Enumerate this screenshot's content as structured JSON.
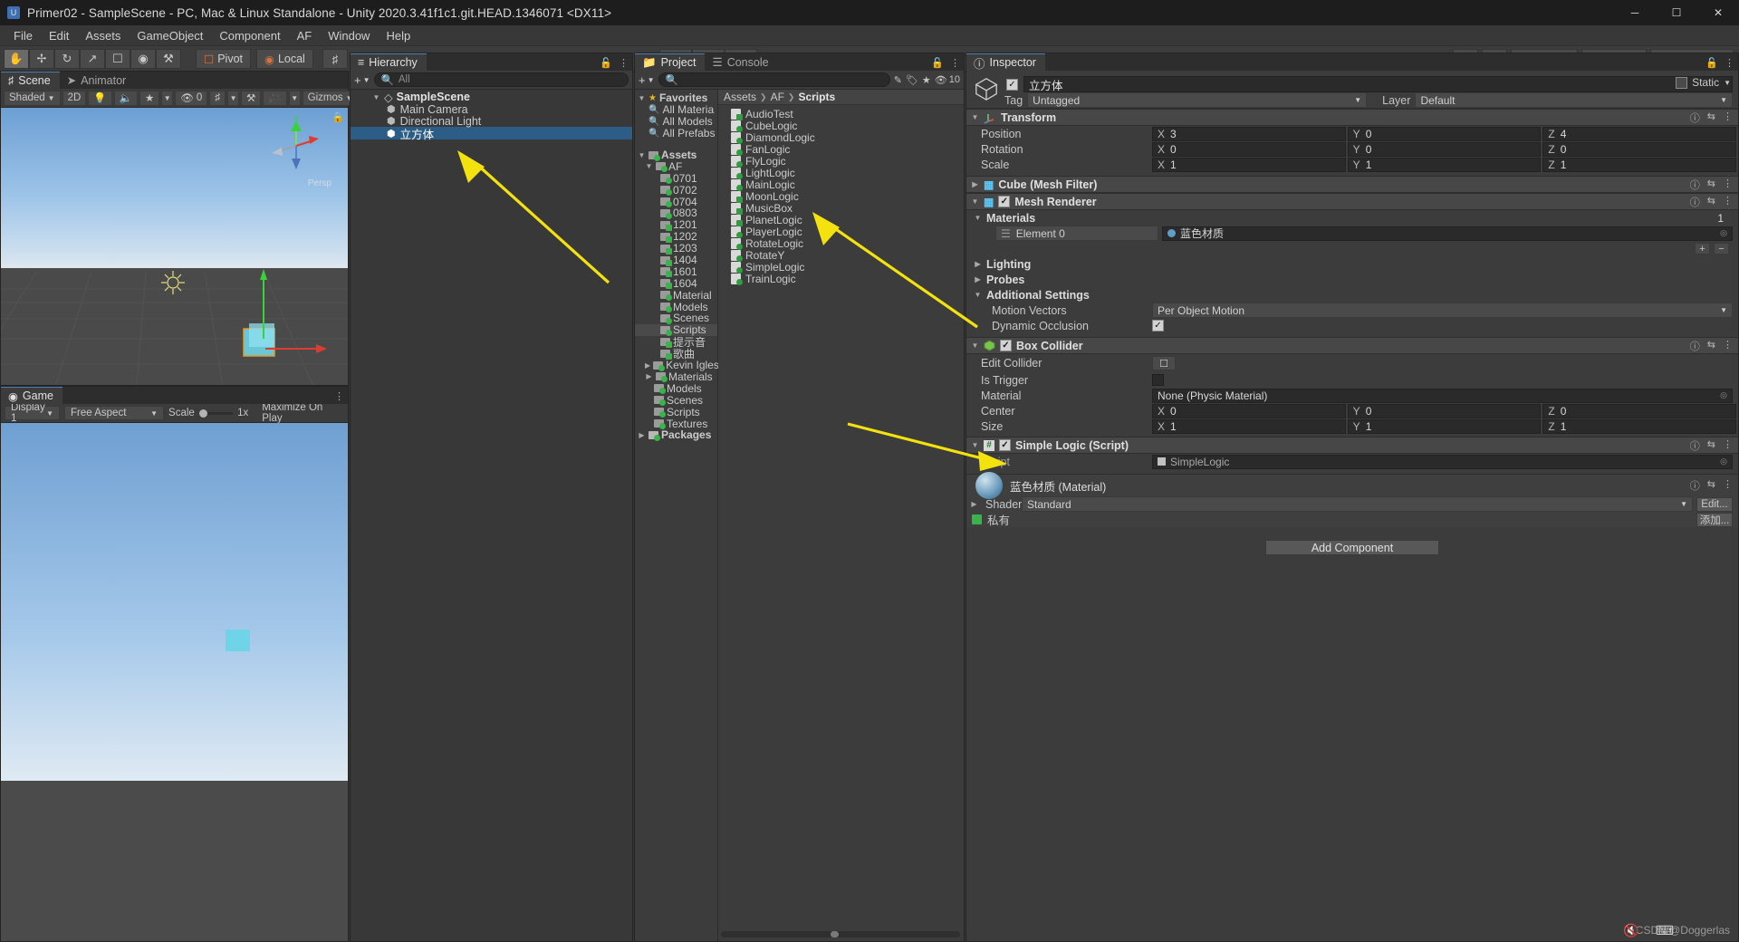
{
  "titlebar": {
    "title": "Primer02 - SampleScene - PC, Mac & Linux Standalone - Unity 2020.3.41f1c1.git.HEAD.1346071 <DX11>",
    "minimize": "─",
    "maximize": "☐",
    "close": "✕"
  },
  "menu": [
    "File",
    "Edit",
    "Assets",
    "GameObject",
    "Component",
    "AF",
    "Window",
    "Help"
  ],
  "toolbar": {
    "tools": [
      "hand-tool",
      "move-tool",
      "rotate-tool",
      "scale-tool",
      "rect-tool",
      "transform-tool",
      "custom-tool"
    ],
    "pivot": "Pivot",
    "local": "Local",
    "grid": "grid-snap",
    "play": "▶",
    "pause": "❙❙",
    "step": "▶❙",
    "cloud": "cloud-icon",
    "collab": "collab-icon",
    "account": "Account",
    "layers": "Layers",
    "layout": "Layout"
  },
  "scene": {
    "tabs": [
      {
        "label": "Scene",
        "icon": "grid-icon",
        "selected": true
      },
      {
        "label": "Animator",
        "icon": "animator-icon",
        "selected": false
      }
    ],
    "draw_mode": "Shaded",
    "mode_2d": "2D",
    "lighting": "light-icon",
    "audio": "audio-icon",
    "fx": "fx-icon",
    "hidden_count": "0",
    "grid": "grid-icon",
    "tools": "tools-icon",
    "camera": "camera-icon",
    "gizmos": "Gizmos",
    "persp_label": "Persp",
    "axis_y": "y",
    "axis_x": "x",
    "axis_z": "z"
  },
  "game": {
    "tab": "Game",
    "display": "Display 1",
    "aspect": "Free Aspect",
    "scale_label": "Scale",
    "scale_value": "1x",
    "maximize": "Maximize On Play"
  },
  "hierarchy": {
    "tab": "Hierarchy",
    "add_label": "+",
    "search_placeholder": "All",
    "items": [
      {
        "label": "SampleScene",
        "depth": 0,
        "icon": "scene-icon",
        "selected": false,
        "expanded": true
      },
      {
        "label": "Main Camera",
        "depth": 1,
        "icon": "gameobject-icon",
        "selected": false
      },
      {
        "label": "Directional Light",
        "depth": 1,
        "icon": "gameobject-icon",
        "selected": false
      },
      {
        "label": "立方体",
        "depth": 1,
        "icon": "gameobject-icon",
        "selected": true
      }
    ]
  },
  "project": {
    "tabs": [
      {
        "label": "Project",
        "icon": "folder-icon",
        "selected": true
      },
      {
        "label": "Console",
        "icon": "console-icon",
        "selected": false
      }
    ],
    "search_placeholder": "",
    "filter_icons": [
      "asset-filter-icon",
      "label-filter-icon",
      "favorite-icon"
    ],
    "hidden_count": "10",
    "breadcrumb": [
      "Assets",
      "AF",
      "Scripts"
    ],
    "tree": [
      {
        "label": "Favorites",
        "depth": 0,
        "icon": "star-icon",
        "expanded": true
      },
      {
        "label": "All Materia",
        "depth": 1,
        "icon": "search-icon"
      },
      {
        "label": "All Models",
        "depth": 1,
        "icon": "search-icon"
      },
      {
        "label": "All Prefabs",
        "depth": 1,
        "icon": "search-icon"
      },
      {
        "label": "",
        "depth": 0,
        "icon": "spacer"
      },
      {
        "label": "Assets",
        "depth": 0,
        "icon": "folder-icon",
        "expanded": true
      },
      {
        "label": "AF",
        "depth": 1,
        "icon": "folder-icon",
        "expanded": true
      },
      {
        "label": "0701",
        "depth": 2,
        "icon": "folder-icon"
      },
      {
        "label": "0702",
        "depth": 2,
        "icon": "folder-icon"
      },
      {
        "label": "0704",
        "depth": 2,
        "icon": "folder-icon"
      },
      {
        "label": "0803",
        "depth": 2,
        "icon": "folder-icon"
      },
      {
        "label": "1201",
        "depth": 2,
        "icon": "folder-icon"
      },
      {
        "label": "1202",
        "depth": 2,
        "icon": "folder-icon"
      },
      {
        "label": "1203",
        "depth": 2,
        "icon": "folder-icon"
      },
      {
        "label": "1404",
        "depth": 2,
        "icon": "folder-icon"
      },
      {
        "label": "1601",
        "depth": 2,
        "icon": "folder-icon"
      },
      {
        "label": "1604",
        "depth": 2,
        "icon": "folder-icon"
      },
      {
        "label": "Material",
        "depth": 2,
        "icon": "folder-icon"
      },
      {
        "label": "Models",
        "depth": 2,
        "icon": "folder-icon"
      },
      {
        "label": "Scenes",
        "depth": 2,
        "icon": "folder-icon"
      },
      {
        "label": "Scripts",
        "depth": 2,
        "icon": "folder-icon",
        "selected": true
      },
      {
        "label": "提示音",
        "depth": 2,
        "icon": "folder-icon"
      },
      {
        "label": "歌曲",
        "depth": 2,
        "icon": "folder-icon"
      },
      {
        "label": "Kevin Igles",
        "depth": 1,
        "icon": "folder-icon",
        "collapsed": true
      },
      {
        "label": "Materials",
        "depth": 1,
        "icon": "folder-icon",
        "collapsed": true
      },
      {
        "label": "Models",
        "depth": 1,
        "icon": "folder-icon"
      },
      {
        "label": "Scenes",
        "depth": 1,
        "icon": "folder-icon"
      },
      {
        "label": "Scripts",
        "depth": 1,
        "icon": "folder-icon"
      },
      {
        "label": "Textures",
        "depth": 1,
        "icon": "folder-icon"
      },
      {
        "label": "Packages",
        "depth": 0,
        "icon": "folder-icon",
        "collapsed": true
      }
    ],
    "assets": [
      {
        "label": "AudioTest",
        "icon": "script-icon"
      },
      {
        "label": "CubeLogic",
        "icon": "script-icon"
      },
      {
        "label": "DiamondLogic",
        "icon": "script-icon"
      },
      {
        "label": "FanLogic",
        "icon": "script-icon"
      },
      {
        "label": "FlyLogic",
        "icon": "script-icon"
      },
      {
        "label": "LightLogic",
        "icon": "script-icon"
      },
      {
        "label": "MainLogic",
        "icon": "script-icon"
      },
      {
        "label": "MoonLogic",
        "icon": "script-icon"
      },
      {
        "label": "MusicBox",
        "icon": "script-icon"
      },
      {
        "label": "PlanetLogic",
        "icon": "script-icon"
      },
      {
        "label": "PlayerLogic",
        "icon": "script-icon"
      },
      {
        "label": "RotateLogic",
        "icon": "script-icon"
      },
      {
        "label": "RotateY",
        "icon": "script-icon"
      },
      {
        "label": "SimpleLogic",
        "icon": "script-icon"
      },
      {
        "label": "TrainLogic",
        "icon": "script-icon"
      }
    ]
  },
  "inspector": {
    "tab": "Inspector",
    "object_name": "立方体",
    "enabled": true,
    "static_label": "Static",
    "tag_label": "Tag",
    "tag_value": "Untagged",
    "layer_label": "Layer",
    "layer_value": "Default",
    "transform": {
      "title": "Transform",
      "rows": [
        {
          "label": "Position",
          "x": "3",
          "y": "0",
          "z": "4"
        },
        {
          "label": "Rotation",
          "x": "0",
          "y": "0",
          "z": "0"
        },
        {
          "label": "Scale",
          "x": "1",
          "y": "1",
          "z": "1"
        }
      ]
    },
    "mesh_filter": {
      "title": "Cube (Mesh Filter)"
    },
    "mesh_renderer": {
      "title": "Mesh Renderer",
      "enabled": true,
      "materials_label": "Materials",
      "materials_count": "1",
      "element_label": "Element 0",
      "element_value": "蓝色材质",
      "lighting_label": "Lighting",
      "probes_label": "Probes",
      "additional_label": "Additional Settings",
      "motion_vectors_label": "Motion Vectors",
      "motion_vectors_value": "Per Object Motion",
      "dynamic_occlusion_label": "Dynamic Occlusion",
      "dynamic_occlusion_checked": true
    },
    "box_collider": {
      "title": "Box Collider",
      "enabled": true,
      "edit_collider_label": "Edit Collider",
      "is_trigger_label": "Is Trigger",
      "material_label": "Material",
      "material_value": "None (Physic Material)",
      "center_label": "Center",
      "center": {
        "x": "0",
        "y": "0",
        "z": "0"
      },
      "size_label": "Size",
      "size": {
        "x": "1",
        "y": "1",
        "z": "1"
      }
    },
    "simple_logic": {
      "title": "Simple Logic (Script)",
      "enabled": true,
      "script_label": "Script",
      "script_value": "SimpleLogic"
    },
    "material": {
      "title": "蓝色材质 (Material)",
      "shader_label": "Shader",
      "shader_value": "Standard",
      "edit_button": "Edit...",
      "private_label": "私有",
      "add_button": "添加..."
    },
    "add_component": "Add Component"
  },
  "watermark": "CSDN @Doggerlas",
  "colors": {
    "accent_blue": "#2b5d87",
    "arrow_yellow": "#f3e20e",
    "green_icon": "#3ab34a",
    "panel_bg": "#383838"
  }
}
